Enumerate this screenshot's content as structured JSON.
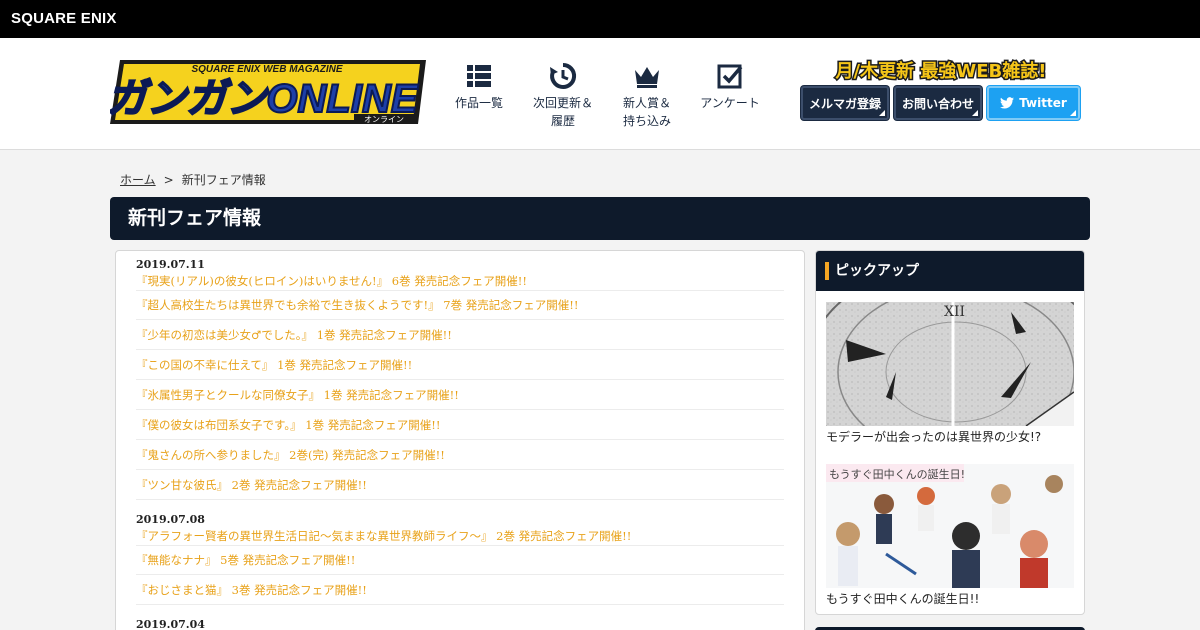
{
  "topbar": {
    "brand": "SQUARE ENIX"
  },
  "header": {
    "logo_text": "ガンガンONLINE",
    "logo_sub": "SQUARE ENIX WEB MAGAZINE",
    "logo_kana": "オンライン",
    "tagline": "月/木更新 最強WEB雑誌!",
    "nav": [
      {
        "label1": "作品一覧",
        "label2": "",
        "icon": "grid-icon"
      },
      {
        "label1": "次回更新＆",
        "label2": "履歴",
        "icon": "refresh-clock-icon"
      },
      {
        "label1": "新人賞＆",
        "label2": "持ち込み",
        "icon": "crown-icon"
      },
      {
        "label1": "アンケート",
        "label2": "",
        "icon": "checkbox-icon"
      }
    ],
    "buttons": {
      "mailmag": "メルマガ登録",
      "contact": "お問い合わせ",
      "twitter": "Twitter"
    },
    "colors": {
      "navy": "#1b2a41",
      "twitter": "#1da1f2",
      "accent": "#e8a21a"
    }
  },
  "breadcrumb": {
    "home": "ホーム",
    "separator": ">",
    "current": "新刊フェア情報"
  },
  "page_title": "新刊フェア情報",
  "groups": [
    {
      "date": "2019.07.11",
      "items": [
        "『現実(リアル)の彼女(ヒロイン)はいりません!』 6巻 発売記念フェア開催!!",
        "『超人高校生たちは異世界でも余裕で生き抜くようです!』 7巻 発売記念フェア開催!!",
        "『少年の初恋は美少女♂でした。』 1巻 発売記念フェア開催!!",
        "『この国の不幸に仕えて』 1巻 発売記念フェア開催!!",
        "『氷属性男子とクールな同僚女子』 1巻 発売記念フェア開催!!",
        "『僕の彼女は布団系女子です。』 1巻 発売記念フェア開催!!",
        "『鬼さんの所へ参りました』 2巻(完) 発売記念フェア開催!!",
        "『ツン甘な彼氏』 2巻 発売記念フェア開催!!"
      ]
    },
    {
      "date": "2019.07.08",
      "items": [
        "『アラフォー賢者の異世界生活日記～気ままな異世界教師ライフ～』 2巻 発売記念フェア開催!!",
        "『無能なナナ』 5巻 発売記念フェア開催!!",
        "『おじさまと猫』 3巻 発売記念フェア開催!!"
      ]
    },
    {
      "date": "2019.07.04",
      "items": []
    }
  ],
  "sidebar": {
    "heading": "ピックアップ",
    "picks": [
      {
        "caption": "モデラーが出会ったのは異世界の少女!?",
        "image": "clock-illustration"
      },
      {
        "caption": "もうすぐ田中くんの誕生日!!",
        "image_label": "もうすぐ田中くんの誕生日!",
        "image": "characters-illustration"
      }
    ]
  }
}
